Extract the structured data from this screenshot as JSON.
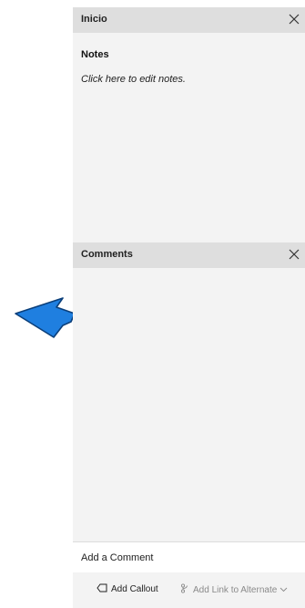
{
  "notes_panel": {
    "header_title": "Inicio",
    "section_title": "Notes",
    "placeholder_text": "Click here to edit notes.",
    "close_icon": "close-icon"
  },
  "comments_panel": {
    "header_title": "Comments",
    "close_icon": "close-icon",
    "input_placeholder": "Add a Comment"
  },
  "footer": {
    "add_callout_label": "Add Callout",
    "add_callout_icon": "callout-icon",
    "add_link_label": "Add Link to Alternate",
    "add_link_icon": "link-branch-icon",
    "add_link_chevron": "chevron-down-icon"
  },
  "overlay": {
    "pointer_icon": "arrow-pointer-icon",
    "pointer_color": "#1f7fe0"
  },
  "colors": {
    "panel_bg": "#f3f3f3",
    "header_bg": "#dedede",
    "input_bg": "#ffffff"
  }
}
